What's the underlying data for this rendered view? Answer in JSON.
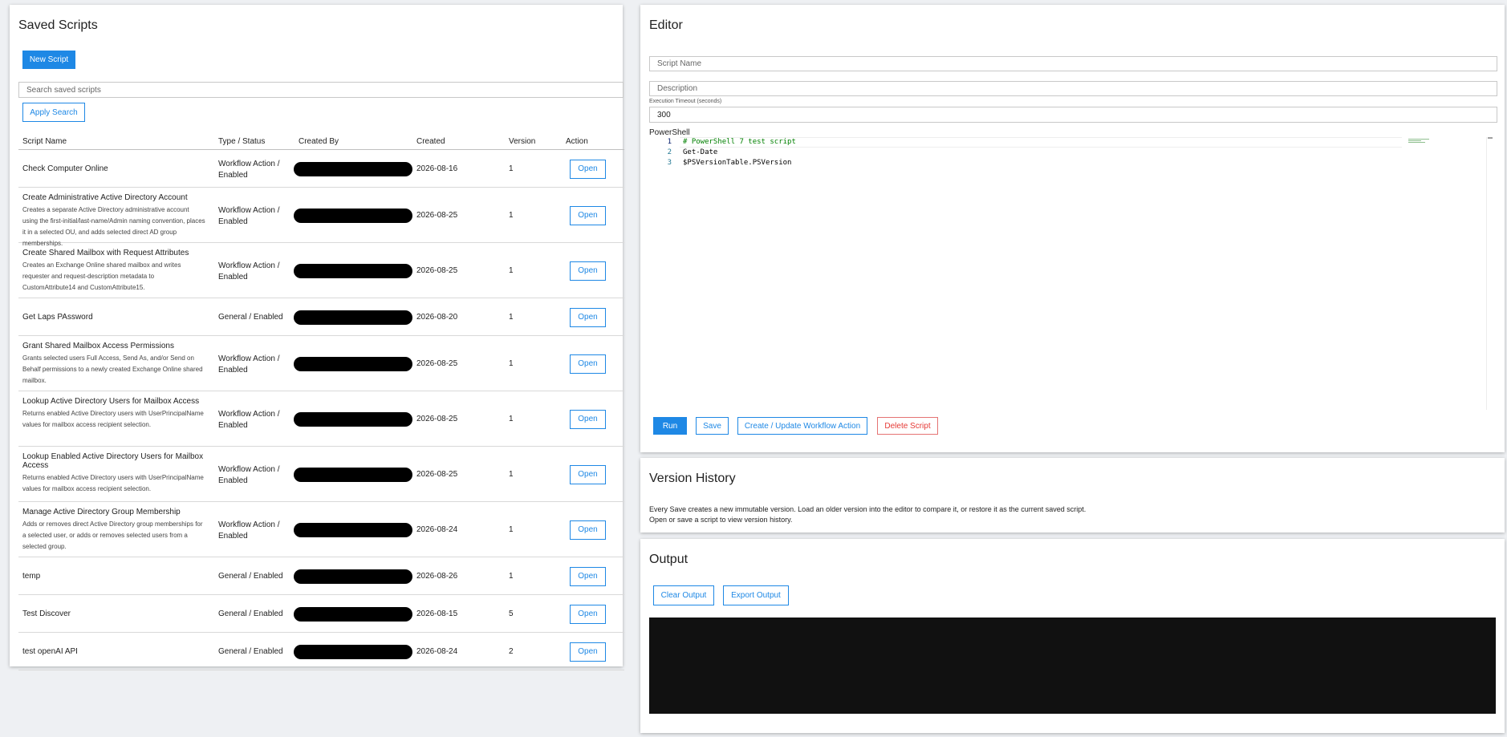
{
  "saved_scripts": {
    "title": "Saved Scripts",
    "new_script_label": "New Script",
    "search_placeholder": "Search saved scripts",
    "apply_search_label": "Apply Search",
    "columns": {
      "name": "Script Name",
      "type": "Type / Status",
      "created_by": "Created By",
      "created": "Created",
      "version": "Version",
      "action": "Action"
    },
    "rows": [
      {
        "name": "Check Computer Online",
        "desc": "",
        "type": "Workflow Action / Enabled",
        "created": "2026-08-16",
        "version": "1",
        "action": "Open"
      },
      {
        "name": "Create Administrative Active Directory Account",
        "desc": "Creates a separate Active Directory administrative account using the first-initial/last-name/Admin naming convention, places it in a selected OU, and adds selected direct AD group memberships.",
        "type": "Workflow Action / Enabled",
        "created": "2026-08-25",
        "version": "1",
        "action": "Open"
      },
      {
        "name": "Create Shared Mailbox with Request Attributes",
        "desc": "Creates an Exchange Online shared mailbox and writes requester and request-description metadata to CustomAttribute14 and CustomAttribute15.",
        "type": "Workflow Action / Enabled",
        "created": "2026-08-25",
        "version": "1",
        "action": "Open"
      },
      {
        "name": "Get Laps PAssword",
        "desc": "",
        "type": "General / Enabled",
        "created": "2026-08-20",
        "version": "1",
        "action": "Open"
      },
      {
        "name": "Grant Shared Mailbox Access Permissions",
        "desc": "Grants selected users Full Access, Send As, and/or Send on Behalf permissions to a newly created Exchange Online shared mailbox.",
        "type": "Workflow Action / Enabled",
        "created": "2026-08-25",
        "version": "1",
        "action": "Open"
      },
      {
        "name": "Lookup Active Directory Users for Mailbox Access",
        "desc": "Returns enabled Active Directory users with UserPrincipalName values for mailbox access recipient selection.",
        "type": "Workflow Action / Enabled",
        "created": "2026-08-25",
        "version": "1",
        "action": "Open"
      },
      {
        "name": "Lookup Enabled Active Directory Users for Mailbox Access",
        "desc": "Returns enabled Active Directory users with UserPrincipalName values for mailbox access recipient selection.",
        "type": "Workflow Action / Enabled",
        "created": "2026-08-25",
        "version": "1",
        "action": "Open"
      },
      {
        "name": "Manage Active Directory Group Membership",
        "desc": "Adds or removes direct Active Directory group memberships for a selected user, or adds or removes selected users from a selected group.",
        "type": "Workflow Action / Enabled",
        "created": "2026-08-24",
        "version": "1",
        "action": "Open"
      },
      {
        "name": "temp",
        "desc": "",
        "type": "General / Enabled",
        "created": "2026-08-26",
        "version": "1",
        "action": "Open"
      },
      {
        "name": "Test Discover",
        "desc": "",
        "type": "General / Enabled",
        "created": "2026-08-15",
        "version": "5",
        "action": "Open"
      },
      {
        "name": "test openAI API",
        "desc": "",
        "type": "General / Enabled",
        "created": "2026-08-24",
        "version": "2",
        "action": "Open"
      }
    ]
  },
  "editor": {
    "title": "Editor",
    "script_name_placeholder": "Script Name",
    "description_placeholder": "Description",
    "timeout_label": "Execution Timeout (seconds)",
    "timeout_value": "300",
    "language": "PowerShell",
    "code_lines": [
      {
        "num": "1",
        "text": "# PowerShell 7 test script"
      },
      {
        "num": "2",
        "text": "Get-Date"
      },
      {
        "num": "3",
        "text": "$PSVersionTable.PSVersion"
      }
    ],
    "run_label": "Run",
    "save_label": "Save",
    "workflow_label": "Create / Update Workflow Action",
    "delete_label": "Delete Script"
  },
  "version_history": {
    "title": "Version History",
    "line1": "Every Save creates a new immutable version. Load an older version into the editor to compare it, or restore it as the current saved script.",
    "line2": "Open or save a script to view version history."
  },
  "output": {
    "title": "Output",
    "clear_label": "Clear Output",
    "export_label": "Export Output"
  },
  "colors": {
    "accent": "#1e88e5",
    "danger": "#e53935",
    "console_bg": "#111111",
    "comment": "#008000"
  }
}
